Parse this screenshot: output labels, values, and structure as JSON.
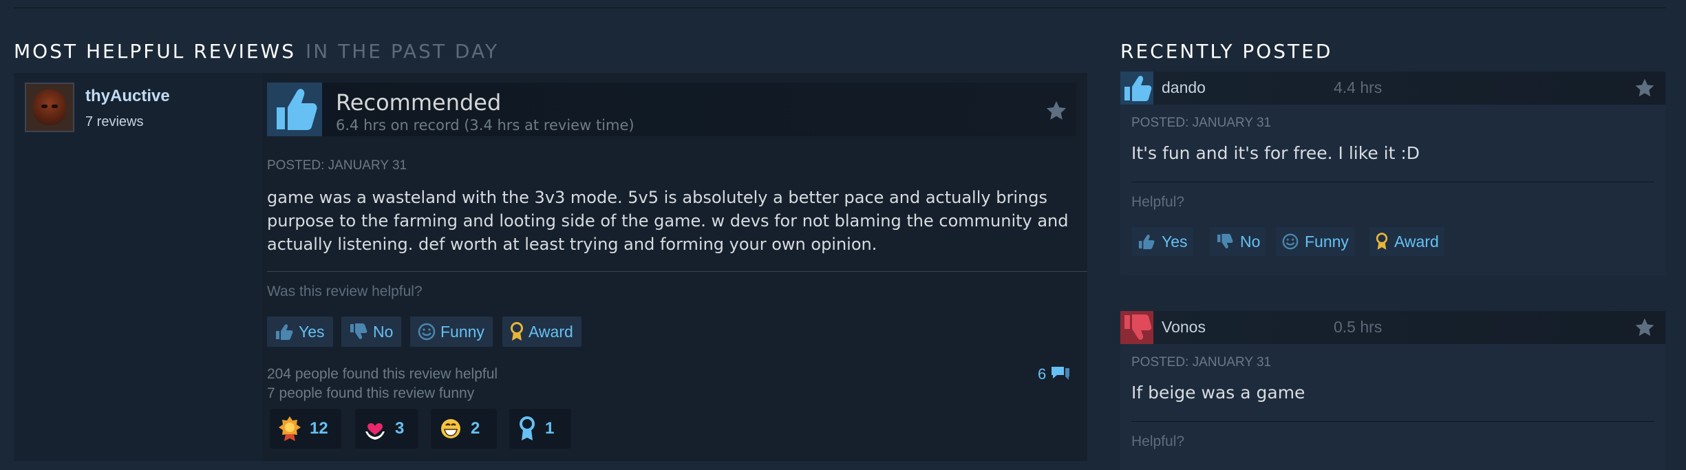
{
  "section": {
    "title": "MOST HELPFUL REVIEWS",
    "subtitle": "IN THE PAST DAY"
  },
  "review": {
    "username": "thyAuctive",
    "user_reviews": "7 reviews",
    "verdict": "Recommended",
    "hours": "6.4 hrs on record (3.4 hrs at review time)",
    "posted": "POSTED: JANUARY 31",
    "text_lines": [
      "game was a wasteland with the 3v3 mode. 5v5 is absolutely a better pace and actually brings",
      "purpose to the farming and looting side of the game. w devs for not blaming the community and",
      "actually listening. def worth at least trying and forming your own opinion."
    ],
    "helpful_question": "Was this review helpful?",
    "buttons": {
      "yes": "Yes",
      "no": "No",
      "funny": "Funny",
      "award": "Award"
    },
    "helpful_count": "204 people found this review helpful",
    "funny_count": "7 people found this review funny",
    "comments": "6",
    "awards": [
      {
        "icon": "gold-medal-icon",
        "count": "12"
      },
      {
        "icon": "heart-hands-icon",
        "count": "3"
      },
      {
        "icon": "grin-face-icon",
        "count": "2"
      },
      {
        "icon": "ribbon-icon",
        "count": "1"
      }
    ]
  },
  "recent": {
    "title": "RECENTLY POSTED",
    "items": [
      {
        "name": "dando",
        "hours": "4.4 hrs",
        "recommended": true,
        "posted": "POSTED: JANUARY 31",
        "text": "It's fun and it's for free. I like it :D",
        "helpful": "Helpful?"
      },
      {
        "name": "Vonos",
        "hours": "0.5 hrs",
        "recommended": false,
        "posted": "POSTED: JANUARY 31",
        "text": "If beige was a game",
        "helpful": "Helpful?"
      }
    ],
    "buttons": {
      "yes": "Yes",
      "no": "No",
      "funny": "Funny",
      "award": "Award"
    }
  },
  "colors": {
    "accent": "#66c0f4",
    "thumb_up_bg": "#21415f",
    "thumb_down_bg": "#8b2a35"
  }
}
